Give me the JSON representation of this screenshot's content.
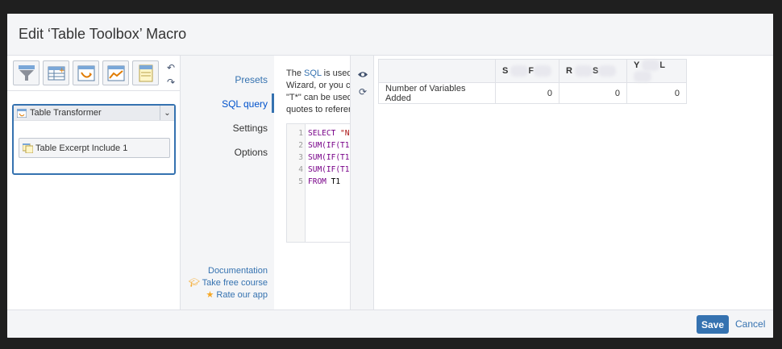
{
  "dialog": {
    "title": "Edit ‘Table Toolbox’ Macro",
    "save_label": "Save",
    "cancel_label": "Cancel"
  },
  "toolbar": {
    "tools": [
      {
        "icon": "filter-table-icon"
      },
      {
        "icon": "add-column-icon"
      },
      {
        "icon": "transform-table-icon"
      },
      {
        "icon": "chart-icon"
      },
      {
        "icon": "excerpt-icon"
      }
    ],
    "undo_icon": "undo-icon",
    "redo_icon": "redo-icon"
  },
  "tree": {
    "transformer_label": "Table Transformer",
    "excerpt_label": "Table Excerpt Include 1"
  },
  "nav": {
    "items": [
      "Presets",
      "SQL query",
      "Settings",
      "Options"
    ],
    "active": "SQL query",
    "documentation": "Documentation",
    "course": "Take free course",
    "rate": "Rate our app"
  },
  "sql": {
    "desc_lines": [
      [
        "The ",
        "SQL",
        " is used t"
      ],
      [
        "Wizard, or you ca"
      ],
      [
        "\"T*\" can be used"
      ],
      [
        "quotes to referen"
      ]
    ],
    "code_lines": [
      {
        "n": "1",
        "kw": "SELECT ",
        "str": "\"N",
        "rest": ""
      },
      {
        "n": "2",
        "kw": "SUM(IF(T1",
        "str": "",
        "rest": ""
      },
      {
        "n": "3",
        "kw": "SUM(IF(T1",
        "str": "",
        "rest": ""
      },
      {
        "n": "4",
        "kw": "SUM(IF(T1",
        "str": "",
        "rest": ""
      },
      {
        "n": "5",
        "kw": "FROM ",
        "str": "",
        "rest": "T1"
      }
    ]
  },
  "strip": {
    "eye_icon": "eye-icon",
    "refresh_icon": "refresh-icon"
  },
  "preview": {
    "headers": [
      "",
      "S",
      "F",
      "R",
      "S",
      "Y",
      "L"
    ],
    "row_label": "Number of Variables Added",
    "values": [
      "0",
      "0",
      "0"
    ]
  },
  "colors": {
    "accent": "#3572b0",
    "header_bg": "#f4f5f7",
    "border": "#dfe1e6"
  }
}
